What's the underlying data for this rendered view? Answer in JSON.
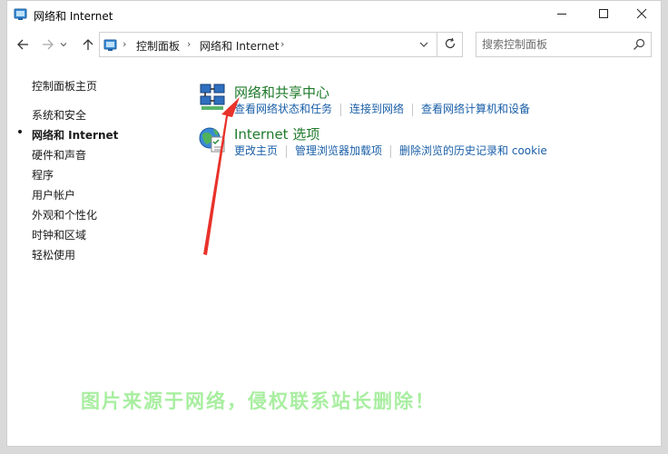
{
  "window": {
    "title": "网络和 Internet",
    "controls": {
      "minimize": "minimize-icon",
      "maximize": "maximize-icon",
      "close": "close-icon"
    }
  },
  "nav": {
    "breadcrumb": [
      "控制面板",
      "网络和 Internet"
    ],
    "search_placeholder": "搜索控制面板"
  },
  "sidebar": {
    "home": "控制面板主页",
    "items": [
      {
        "label": "系统和安全",
        "current": false
      },
      {
        "label": "网络和 Internet",
        "current": true
      },
      {
        "label": "硬件和声音",
        "current": false
      },
      {
        "label": "程序",
        "current": false
      },
      {
        "label": "用户帐户",
        "current": false
      },
      {
        "label": "外观和个性化",
        "current": false
      },
      {
        "label": "时钟和区域",
        "current": false
      },
      {
        "label": "轻松使用",
        "current": false
      }
    ]
  },
  "categories": [
    {
      "title": "网络和共享中心",
      "icon": "network-sharing-icon",
      "links": [
        "查看网络状态和任务",
        "连接到网络",
        "查看网络计算机和设备"
      ]
    },
    {
      "title": "Internet 选项",
      "icon": "internet-options-icon",
      "links": [
        "更改主页",
        "管理浏览器加载项",
        "删除浏览的历史记录和 cookie"
      ]
    }
  ],
  "watermark": "图片来源于网络，侵权联系站长删除！",
  "colors": {
    "category_title": "#1e7a2a",
    "link": "#1a5fa8",
    "arrow": "#e8322a",
    "watermark": "#a8eea0"
  }
}
